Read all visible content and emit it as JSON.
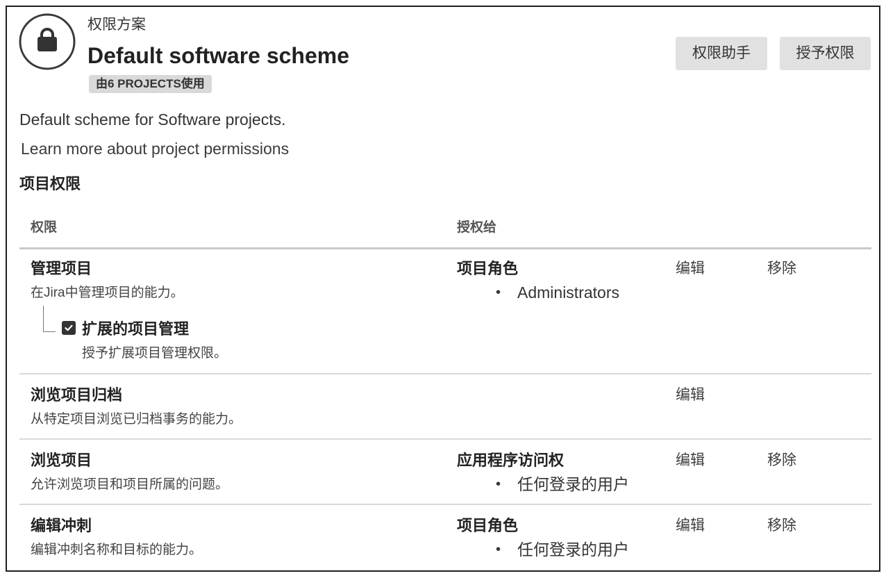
{
  "header": {
    "icon": "lock-icon",
    "scheme_type": "权限方案",
    "title": "Default software scheme",
    "usage_badge": "由6 PROJECTS使用"
  },
  "toolbar": {
    "permission_helper_label": "权限助手",
    "grant_permission_label": "授予权限"
  },
  "description": "Default scheme for Software projects.",
  "learn_more_link": "Learn more about project permissions",
  "section_title": "项目权限",
  "table": {
    "columns": {
      "permission": "权限",
      "granted_to": "授权给"
    },
    "rows": [
      {
        "name": "管理项目",
        "description": "在Jira中管理项目的能力。",
        "sub_permission": {
          "label": "扩展的项目管理",
          "description": "授予扩展项目管理权限。",
          "checked": true
        },
        "grant_type": "项目角色",
        "grantees": [
          "Administrators"
        ],
        "actions": [
          "编辑",
          "移除"
        ]
      },
      {
        "name": "浏览项目归档",
        "description": "从特定项目浏览已归档事务的能力。",
        "actions": [
          "编辑"
        ]
      },
      {
        "name": "浏览项目",
        "description": "允许浏览项目和项目所属的问题。",
        "grant_type": "应用程序访问权",
        "grantees": [
          "任何登录的用户"
        ],
        "actions": [
          "编辑",
          "移除"
        ]
      },
      {
        "name": "编辑冲刺",
        "description": "编辑冲刺名称和目标的能力。",
        "grant_type": "项目角色",
        "grantees": [
          "任何登录的用户"
        ],
        "actions": [
          "编辑",
          "移除"
        ]
      }
    ]
  }
}
